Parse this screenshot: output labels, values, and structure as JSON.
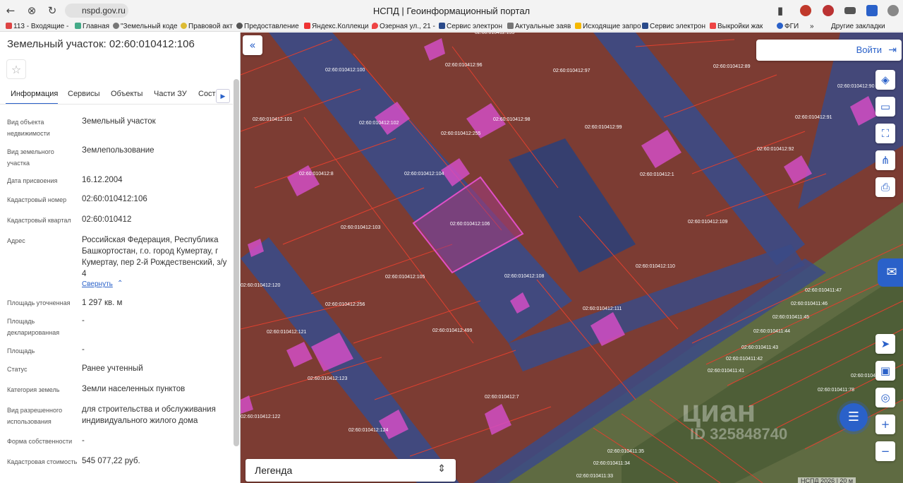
{
  "browser": {
    "url": "nspd.gov.ru",
    "title": "НСПД | Геоинформационный портал",
    "bookmarks": [
      "113 - Входящие -",
      "Главная",
      "\"Земельный коде",
      "Правовой акт",
      "Предоставление",
      "Яндекс.Коллекци",
      "Озерная ул., 21 -",
      "Сервис электрон",
      "Актуальные заяв",
      "Исходящие запро",
      "Сервис электрон",
      "Выкройки жак",
      "ФГИ"
    ],
    "bookmarks_more": "»",
    "other_bookmarks": "Другие закладки"
  },
  "panel": {
    "title": "Земельный участок: 02:60:010412:106",
    "tabs": [
      "Информация",
      "Сервисы",
      "Объекты",
      "Части ЗУ",
      "Соста"
    ],
    "fields": [
      {
        "label": "Вид объекта недвижимости",
        "value": "Земельный участок"
      },
      {
        "label": "Вид земельного участка",
        "value": "Землепользование"
      },
      {
        "label": "Дата присвоения",
        "value": "16.12.2004"
      },
      {
        "label": "Кадастровый номер",
        "value": "02:60:010412:106"
      },
      {
        "label": "Кадастровый квартал",
        "value": "02:60:010412"
      },
      {
        "label": "Адрес",
        "value": "Российская Федерация, Республика Башкортостан, г.о. город Кумертау, г Кумертау, пер 2-й Рождественский, з/у 4"
      },
      {
        "label": "Площадь уточненная",
        "value": "1 297 кв. м"
      },
      {
        "label": "Площадь декларированная",
        "value": "-"
      },
      {
        "label": "Площадь",
        "value": "-"
      },
      {
        "label": "Статус",
        "value": "Ранее учтенный"
      },
      {
        "label": "Категория земель",
        "value": "Земли населенных пунктов"
      },
      {
        "label": "Вид разрешенного использования",
        "value": "для строительства и обслуживания индивидуального жилого дома"
      },
      {
        "label": "Форма собственности",
        "value": "-"
      },
      {
        "label": "Кадастровая стоимость",
        "value": "545 077,22 руб."
      }
    ],
    "collapse_link": "Свернуть"
  },
  "map": {
    "login": "Войти",
    "legend": "Легенда",
    "scale": "НСПД 2026 | 20 м",
    "watermark": "циан",
    "watermark_id": "ID 325848740",
    "parcel_labels": [
      "02:60:010412:100",
      "02:60:010412:96",
      "02:60:010412:97",
      "02:60:010412:101",
      "02:60:010412:102",
      "02:60:010412:255",
      "02:60:010412:98",
      "02:60:010412:99",
      "02:60:010412:8",
      "02:60:010412:104",
      "02:60:010412:1",
      "02:60:010412:103",
      "02:60:010412:106",
      "02:60:010412:109",
      "02:60:010412:105",
      "02:60:010412:108",
      "02:60:010412:110",
      "02:60:010412:256",
      "02:60:010412:111",
      "02:60:010412:121",
      "02:60:010412:499",
      "02:60:010412:123",
      "02:60:010412:7",
      "02:60:010412:122",
      "02:60:010412:124",
      "02:60:010412:120",
      "02:60:010412:89",
      "02:60:010412:90",
      "02:60:010412:91",
      "02:60:010412:92",
      "02:60:010411:47",
      "02:60:010411:46",
      "02:60:010411:45",
      "02:60:010411:44",
      "02:60:010411:43",
      "02:60:010411:42",
      "02:60:010411:41",
      "02:60:010411:78",
      "02:60:010411:17",
      "02:60:010411:35",
      "02:60:010411:34",
      "02:60:010411:33",
      "02:60:010412:155"
    ],
    "colors": {
      "parcel": "#8a3a30",
      "road": "#3a4d8f",
      "selected": "#b03b8f",
      "building": "#d24ec4",
      "greenery": "#6b7a4a"
    }
  }
}
